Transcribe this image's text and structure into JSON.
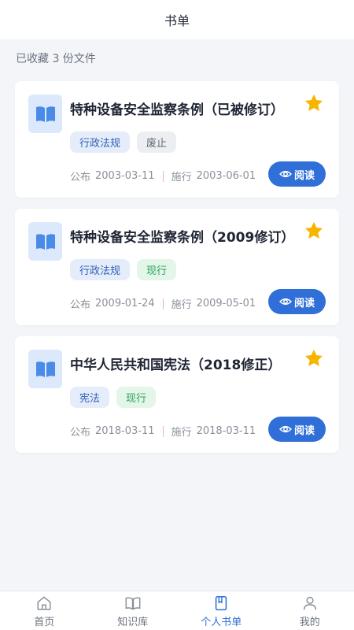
{
  "header": {
    "title": "书单"
  },
  "summary": "已收藏 3 份文件",
  "labels": {
    "publish": "公布",
    "effective": "施行",
    "read": "阅读"
  },
  "colors": {
    "accent": "#2f6fd7",
    "star": "#f7b500",
    "background": "#f3f5f9"
  },
  "cards": [
    {
      "title": "特种设备安全监察条例（已被修订）",
      "tags": [
        {
          "text": "行政法规",
          "kind": "category"
        },
        {
          "text": "废止",
          "kind": "repealed"
        }
      ],
      "publish_date": "2003-03-11",
      "effective_date": "2003-06-01",
      "favorited": true
    },
    {
      "title": "特种设备安全监察条例（2009修订）",
      "tags": [
        {
          "text": "行政法规",
          "kind": "category"
        },
        {
          "text": "现行",
          "kind": "current"
        }
      ],
      "publish_date": "2009-01-24",
      "effective_date": "2009-05-01",
      "favorited": true
    },
    {
      "title": "中华人民共和国宪法（2018修正）",
      "tags": [
        {
          "text": "宪法",
          "kind": "category"
        },
        {
          "text": "现行",
          "kind": "current"
        }
      ],
      "publish_date": "2018-03-11",
      "effective_date": "2018-03-11",
      "favorited": true
    }
  ],
  "tabbar": {
    "items": [
      {
        "label": "首页",
        "icon": "home-icon"
      },
      {
        "label": "知识库",
        "icon": "book-open-icon"
      },
      {
        "label": "个人书单",
        "icon": "booklist-icon",
        "active": true
      },
      {
        "label": "我的",
        "icon": "user-icon"
      }
    ]
  }
}
